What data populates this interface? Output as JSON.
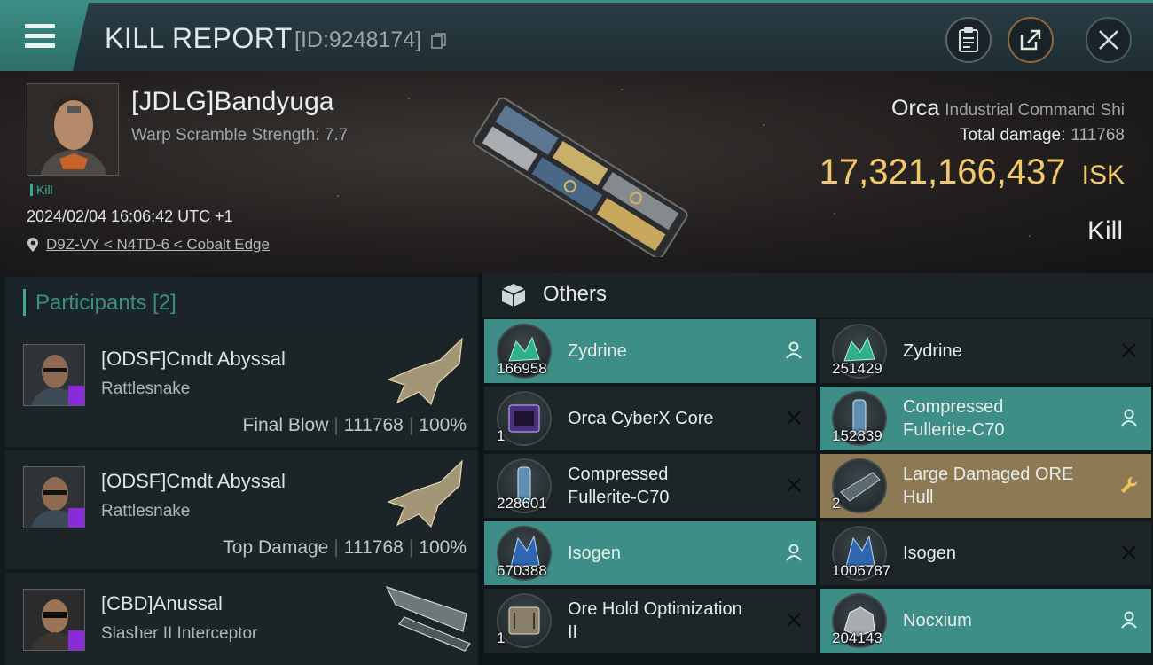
{
  "header": {
    "title": "KILL REPORT",
    "id_label": "[ID:9248174]",
    "menu_icon": "hamburger-menu-icon",
    "buttons": [
      "clipboard-icon",
      "share-icon",
      "close-icon"
    ]
  },
  "victim": {
    "name": "[JDLG]Bandyuga",
    "subtitle": "Warp Scramble Strength: 7.7",
    "tag": "Kill",
    "datetime": "2024/02/04 16:06:42 UTC +1",
    "location": "D9Z-VY < N4TD-6 < Cobalt Edge",
    "ship_name": "Orca",
    "ship_class": "Industrial Command Shi",
    "total_damage_label": "Total damage:",
    "total_damage": "111768",
    "isk_value": "17,321,166,437",
    "isk_unit": "ISK",
    "result": "Kill"
  },
  "participants": {
    "header": "Participants [2]",
    "rows": [
      {
        "name": "[ODSF]Cmdt Abyssal",
        "ship": "Rattlesnake",
        "role": "Final Blow",
        "damage": "111768",
        "percent": "100%"
      },
      {
        "name": "[ODSF]Cmdt Abyssal",
        "ship": "Rattlesnake",
        "role": "Top Damage",
        "damage": "111768",
        "percent": "100%"
      },
      {
        "name": "[CBD]Anussal",
        "ship": "Slasher II Interceptor"
      }
    ]
  },
  "others": {
    "header": "Others",
    "items": [
      {
        "name": "Zydrine",
        "qty": "166958",
        "state": "dropped"
      },
      {
        "name": "Zydrine",
        "qty": "251429",
        "state": "destroyed"
      },
      {
        "name": "Orca CyberX Core",
        "qty": "1",
        "state": "destroyed"
      },
      {
        "name_line1": "Compressed",
        "name_line2": "Fullerite-C70",
        "qty": "152839",
        "state": "dropped"
      },
      {
        "name_line1": "Compressed",
        "name_line2": "Fullerite-C70",
        "qty": "228601",
        "state": "destroyed"
      },
      {
        "name_line1": "Large Damaged ORE",
        "name_line2": "Hull",
        "qty": "2",
        "state": "salvage"
      },
      {
        "name": "Isogen",
        "qty": "670388",
        "state": "dropped"
      },
      {
        "name": "Isogen",
        "qty": "1006787",
        "state": "destroyed"
      },
      {
        "name_line1": "Ore Hold Optimization",
        "name_line2": "II",
        "qty": "1",
        "state": "destroyed"
      },
      {
        "name": "Nocxium",
        "qty": "204143",
        "state": "dropped"
      }
    ]
  },
  "colors": {
    "dropped": "#3c8e86",
    "salvage": "#8d7a55",
    "isk": "#f2c86a",
    "accent": "#3ea99a"
  }
}
